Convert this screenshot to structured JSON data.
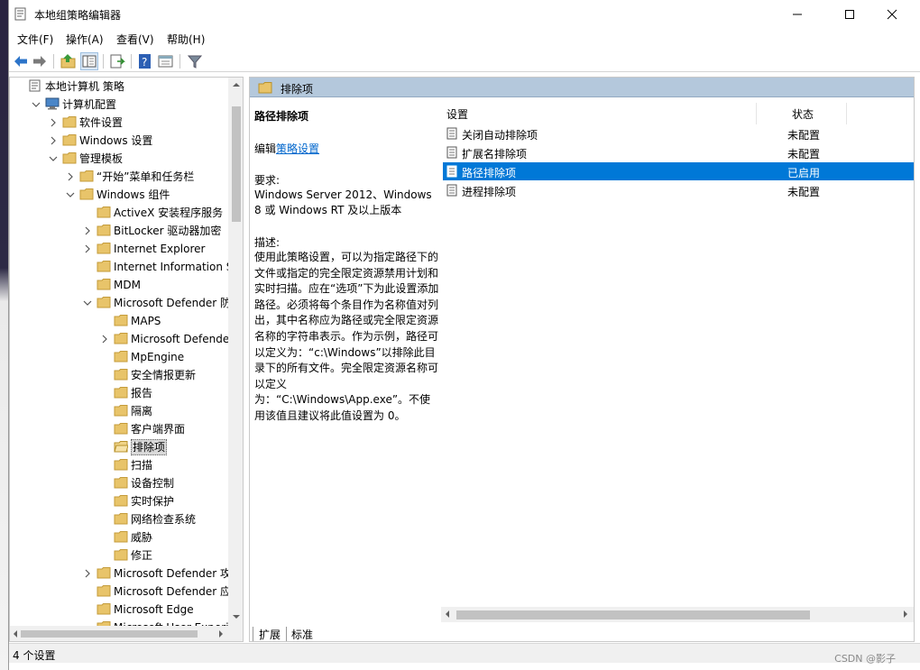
{
  "window": {
    "title": "本地组策略编辑器"
  },
  "menu": [
    {
      "label": "文件(F)"
    },
    {
      "label": "操作(A)"
    },
    {
      "label": "查看(V)"
    },
    {
      "label": "帮助(H)"
    }
  ],
  "toolbar": {
    "icons": [
      "back-icon",
      "forward-icon",
      "up-folder-icon",
      "show-hide-tree-icon",
      "export-list-icon",
      "help-icon",
      "properties-icon",
      "filter-icon"
    ]
  },
  "tree": {
    "items": [
      {
        "label": "本地计算机 策略",
        "level": 0,
        "toggle": "none",
        "icon": "policy-icon"
      },
      {
        "label": "计算机配置",
        "level": 1,
        "toggle": "expanded",
        "icon": "computer-icon"
      },
      {
        "label": "软件设置",
        "level": 2,
        "toggle": "collapsed",
        "icon": "folder-icon"
      },
      {
        "label": "Windows 设置",
        "level": 2,
        "toggle": "collapsed",
        "icon": "folder-icon"
      },
      {
        "label": "管理模板",
        "level": 2,
        "toggle": "expanded",
        "icon": "folder-icon"
      },
      {
        "label": "“开始”菜单和任务栏",
        "level": 3,
        "toggle": "collapsed",
        "icon": "folder-icon"
      },
      {
        "label": "Windows 组件",
        "level": 3,
        "toggle": "expanded",
        "icon": "folder-icon"
      },
      {
        "label": "ActiveX 安装程序服务",
        "level": 4,
        "toggle": "none",
        "icon": "folder-icon"
      },
      {
        "label": "BitLocker 驱动器加密",
        "level": 4,
        "toggle": "collapsed",
        "icon": "folder-icon"
      },
      {
        "label": "Internet Explorer",
        "level": 4,
        "toggle": "collapsed",
        "icon": "folder-icon"
      },
      {
        "label": "Internet Information Serv",
        "level": 4,
        "toggle": "none",
        "icon": "folder-icon"
      },
      {
        "label": "MDM",
        "level": 4,
        "toggle": "none",
        "icon": "folder-icon"
      },
      {
        "label": "Microsoft Defender 防病",
        "level": 4,
        "toggle": "expanded",
        "icon": "folder-icon"
      },
      {
        "label": "MAPS",
        "level": 5,
        "toggle": "none",
        "icon": "folder-icon"
      },
      {
        "label": "Microsoft Defender 攻",
        "level": 5,
        "toggle": "collapsed",
        "icon": "folder-icon"
      },
      {
        "label": "MpEngine",
        "level": 5,
        "toggle": "none",
        "icon": "folder-icon"
      },
      {
        "label": "安全情报更新",
        "level": 5,
        "toggle": "none",
        "icon": "folder-icon"
      },
      {
        "label": "报告",
        "level": 5,
        "toggle": "none",
        "icon": "folder-icon"
      },
      {
        "label": "隔离",
        "level": 5,
        "toggle": "none",
        "icon": "folder-icon"
      },
      {
        "label": "客户端界面",
        "level": 5,
        "toggle": "none",
        "icon": "folder-icon"
      },
      {
        "label": "排除项",
        "level": 5,
        "toggle": "none",
        "icon": "folder-open-icon",
        "selected": true
      },
      {
        "label": "扫描",
        "level": 5,
        "toggle": "none",
        "icon": "folder-icon"
      },
      {
        "label": "设备控制",
        "level": 5,
        "toggle": "none",
        "icon": "folder-icon"
      },
      {
        "label": "实时保护",
        "level": 5,
        "toggle": "none",
        "icon": "folder-icon"
      },
      {
        "label": "网络检查系统",
        "level": 5,
        "toggle": "none",
        "icon": "folder-icon"
      },
      {
        "label": "威胁",
        "level": 5,
        "toggle": "none",
        "icon": "folder-icon"
      },
      {
        "label": "修正",
        "level": 5,
        "toggle": "none",
        "icon": "folder-icon"
      },
      {
        "label": "Microsoft Defender 攻击",
        "level": 4,
        "toggle": "collapsed",
        "icon": "folder-icon"
      },
      {
        "label": "Microsoft Defender 应用",
        "level": 4,
        "toggle": "none",
        "icon": "folder-icon"
      },
      {
        "label": "Microsoft Edge",
        "level": 4,
        "toggle": "none",
        "icon": "folder-icon"
      },
      {
        "label": "Microsoft User Experi",
        "level": 4,
        "toggle": "none",
        "icon": "folder-icon"
      }
    ]
  },
  "pane_header": {
    "title": "排除项"
  },
  "description": {
    "title": "路径排除项",
    "edit_prefix": "编辑",
    "edit_link": "策略设置",
    "requirements_heading": "要求:",
    "requirements": "Windows Server 2012、Windows 8 或 Windows RT 及以上版本",
    "description_heading": "描述:",
    "description": "使用此策略设置，可以为指定路径下的文件或指定的完全限定资源禁用计划和实时扫描。应在“选项”下为此设置添加路径。必须将每个条目作为名称值对列出，其中名称应为路径或完全限定资源名称的字符串表示。作为示例，路径可以定义为：“c:\\Windows”以排除此目录下的所有文件。完全限定资源名称可以定义为：“C:\\Windows\\App.exe”。不使用该值且建议将此值设置为 0。"
  },
  "list": {
    "columns": {
      "setting": "设置",
      "state": "状态"
    },
    "rows": [
      {
        "name": "关闭自动排除项",
        "state": "未配置",
        "selected": false
      },
      {
        "name": "扩展名排除项",
        "state": "未配置",
        "selected": false
      },
      {
        "name": "路径排除项",
        "state": "已启用",
        "selected": true
      },
      {
        "name": "进程排除项",
        "state": "未配置",
        "selected": false
      }
    ]
  },
  "tabs": [
    {
      "label": "扩展",
      "active": true
    },
    {
      "label": "标准",
      "active": false
    }
  ],
  "status": {
    "text": "4 个设置",
    "watermark": "CSDN @影子"
  },
  "colors": {
    "selection": "#0078d7",
    "pane_header": "#b4c8dc",
    "folder": "#e8c46a",
    "link": "#0066cc"
  }
}
